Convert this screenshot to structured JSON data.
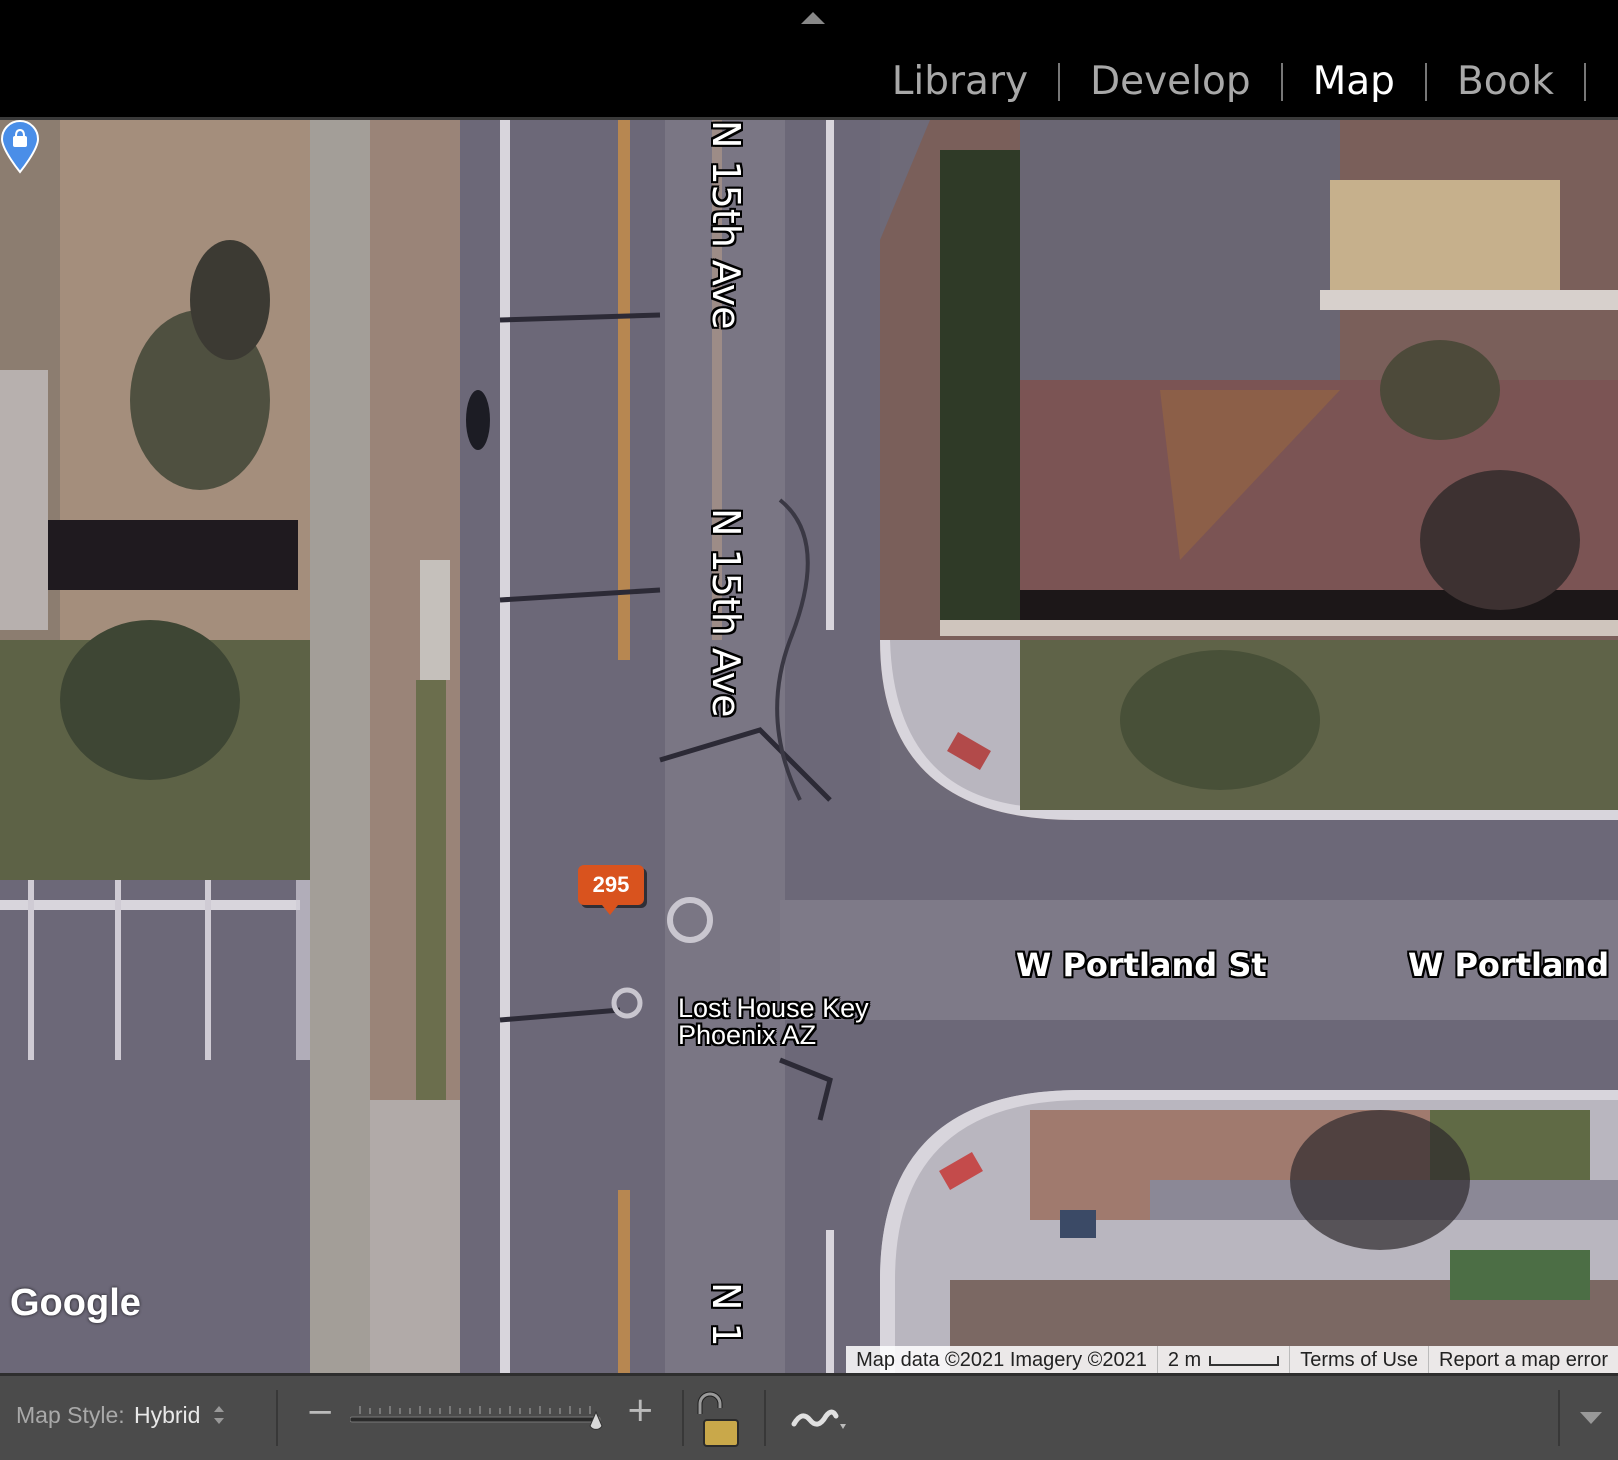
{
  "modules": [
    "Library",
    "Develop",
    "Map",
    "Book"
  ],
  "active_module": "Map",
  "map": {
    "street_labels": {
      "n15_top": "N 15th Ave",
      "n15_mid": "N 15th Ave",
      "n15_bottom": "N 1",
      "portland_1": "W Portland St",
      "portland_2": "W Portland St"
    },
    "photo_marker_count": "295",
    "place": {
      "line1": "Lost House Key",
      "line2": "Phoenix AZ"
    },
    "provider_logo": "Google",
    "attribution": {
      "map_data": "Map data ©2021 Imagery ©2021",
      "scale": "2 m",
      "terms": "Terms of Use",
      "report": "Report a map error"
    }
  },
  "toolbar": {
    "map_style_label": "Map Style:",
    "map_style_value": "Hybrid",
    "zoom_minus": "−",
    "zoom_plus": "+"
  },
  "colors": {
    "marker": "#d9531e",
    "pin": "#4a8ee8",
    "toolbar_bg": "#4b4b4b",
    "lock": "#c9a84a"
  }
}
